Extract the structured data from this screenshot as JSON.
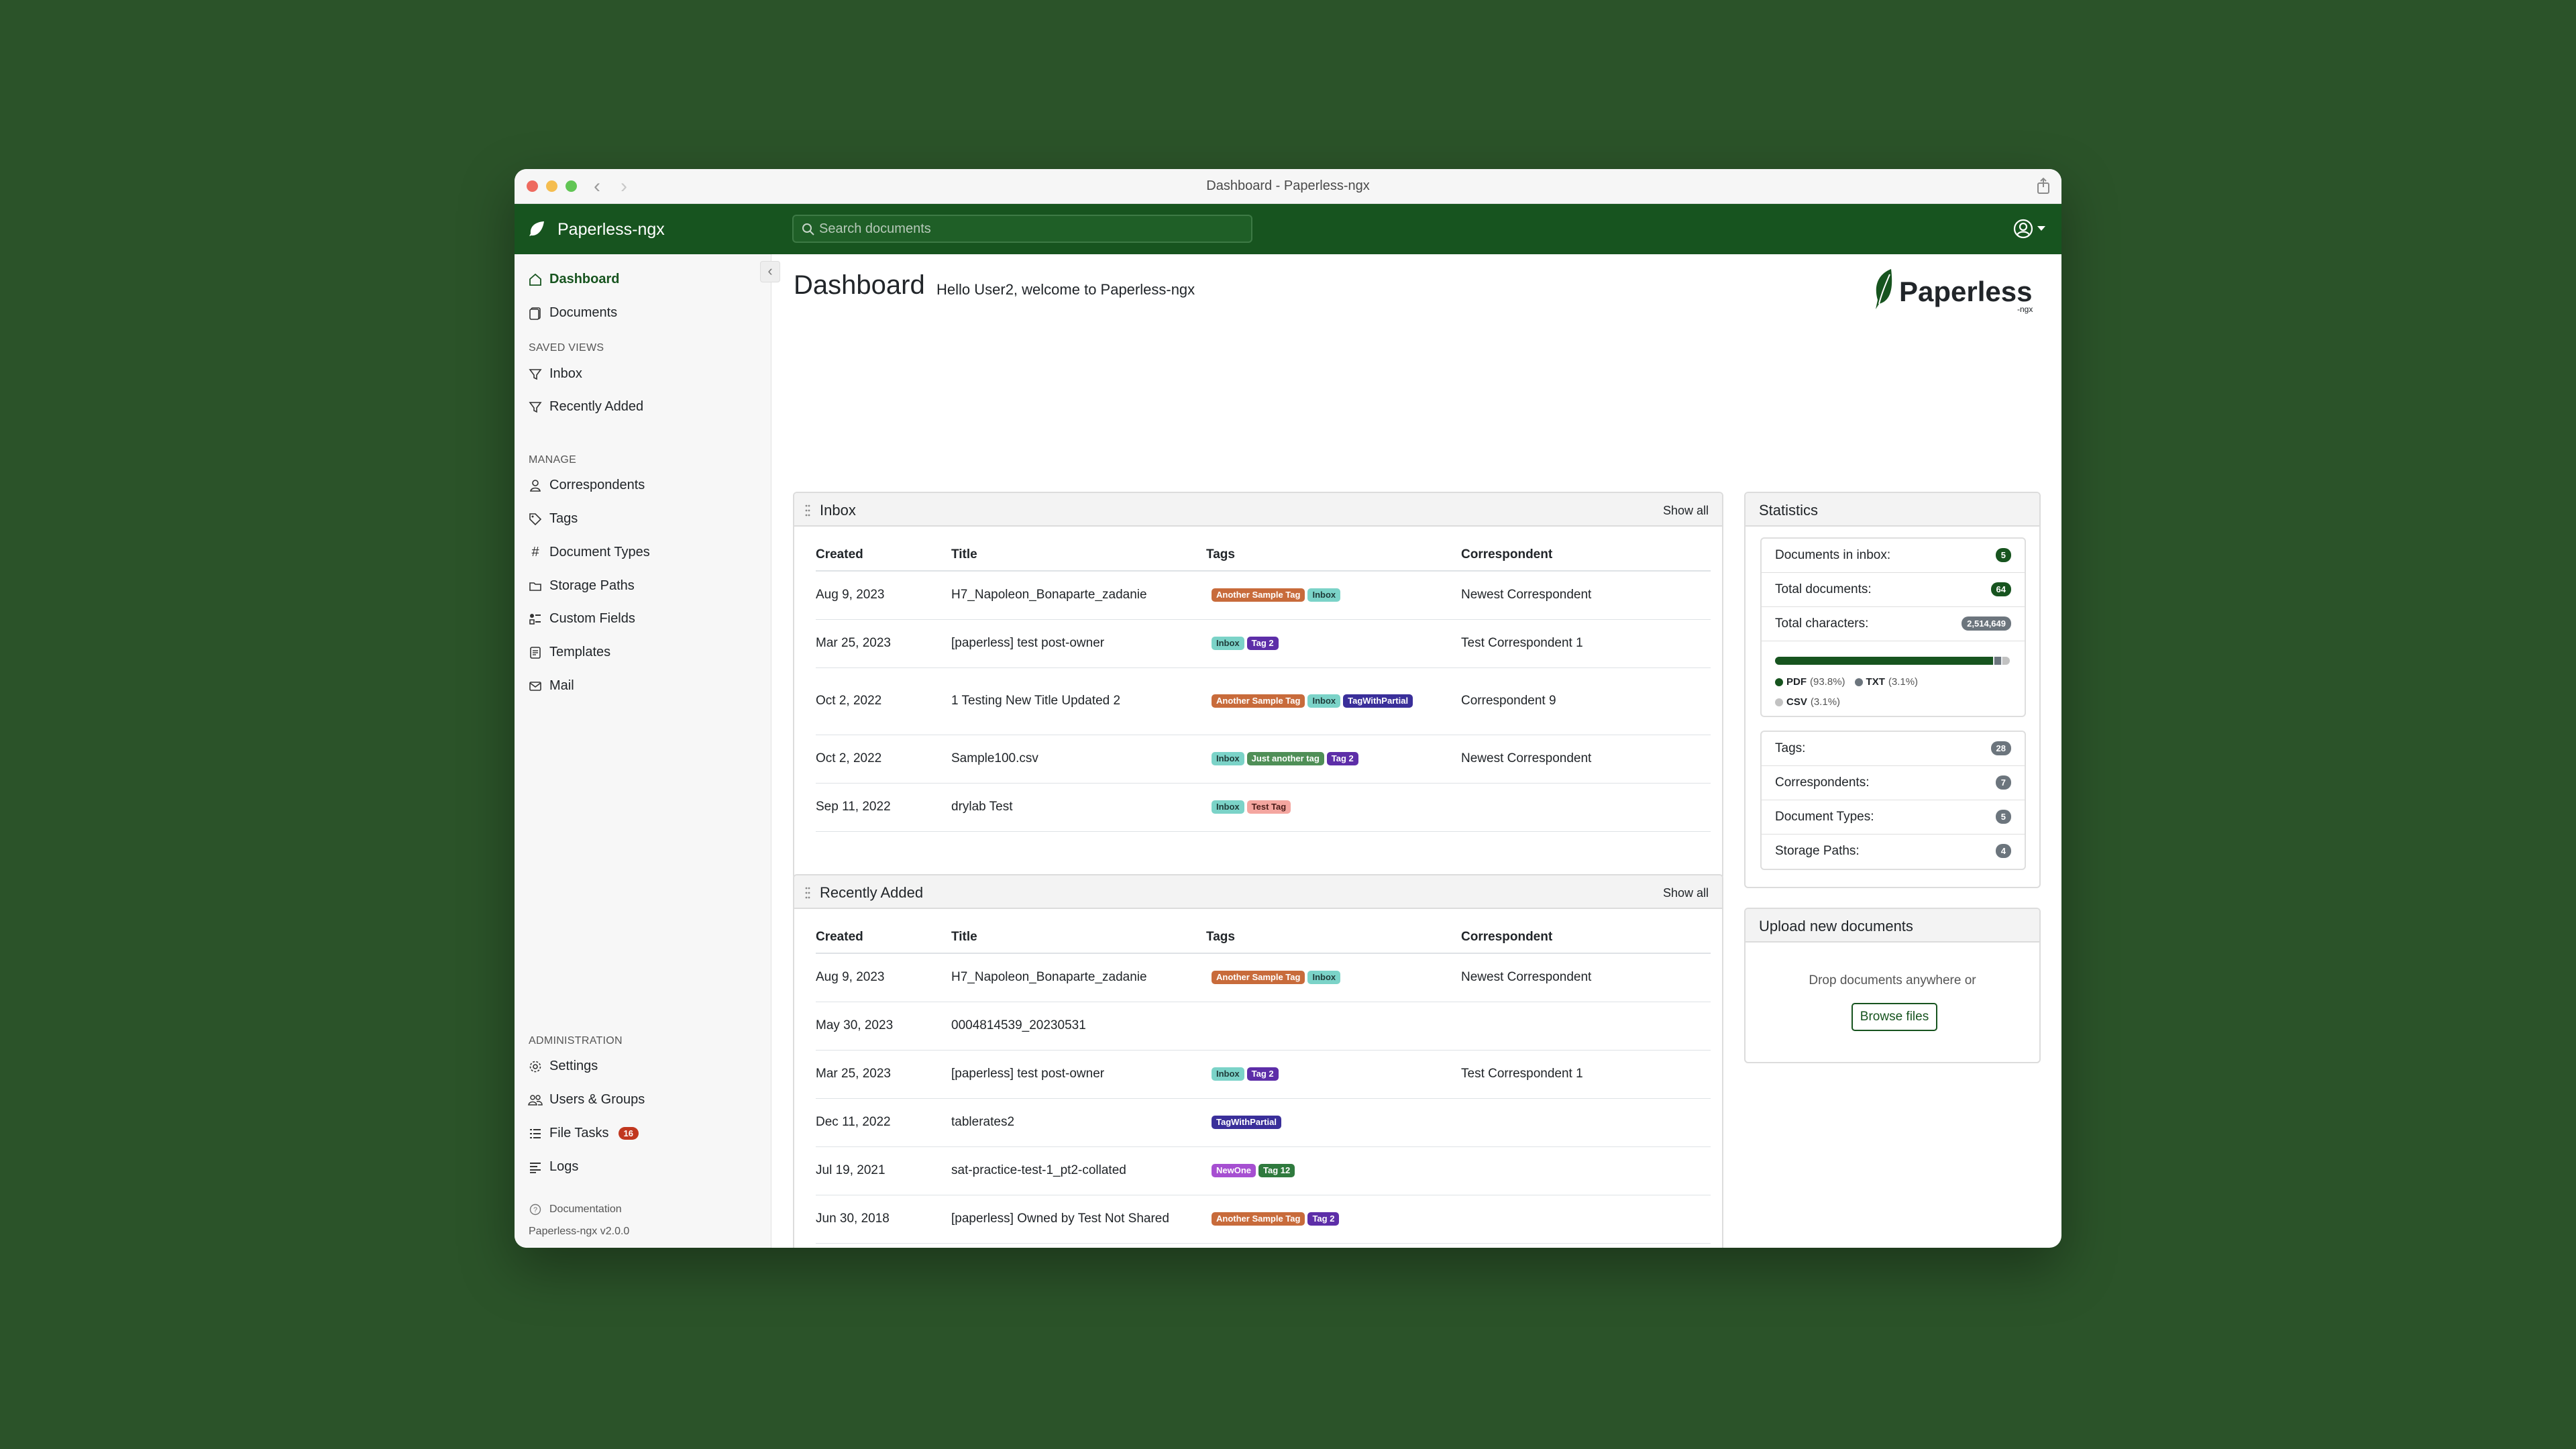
{
  "window": {
    "title": "Dashboard - Paperless-ngx"
  },
  "navbar": {
    "brand": "Paperless-ngx",
    "search_placeholder": "Search documents"
  },
  "sidebar": {
    "items": [
      {
        "label": "Dashboard",
        "icon": "house-icon",
        "active": true
      },
      {
        "label": "Documents",
        "icon": "files-icon"
      }
    ],
    "saved_views_label": "SAVED VIEWS",
    "saved_views": [
      {
        "label": "Inbox",
        "icon": "funnel-icon"
      },
      {
        "label": "Recently Added",
        "icon": "funnel-icon"
      }
    ],
    "manage_label": "MANAGE",
    "manage": [
      {
        "label": "Correspondents",
        "icon": "person-icon"
      },
      {
        "label": "Tags",
        "icon": "tags-icon"
      },
      {
        "label": "Document Types",
        "icon": "hash-icon"
      },
      {
        "label": "Storage Paths",
        "icon": "folder-icon"
      },
      {
        "label": "Custom Fields",
        "icon": "ui-radios-icon"
      },
      {
        "label": "Templates",
        "icon": "file-text-icon"
      },
      {
        "label": "Mail",
        "icon": "envelope-icon"
      }
    ],
    "admin_label": "ADMINISTRATION",
    "admin": [
      {
        "label": "Settings",
        "icon": "gear-icon"
      },
      {
        "label": "Users & Groups",
        "icon": "people-icon"
      },
      {
        "label": "File Tasks",
        "icon": "list-task-icon",
        "badge": "16"
      },
      {
        "label": "Logs",
        "icon": "text-left-icon"
      }
    ],
    "documentation": "Documentation",
    "version": "Paperless-ngx v2.0.0"
  },
  "main": {
    "title": "Dashboard",
    "welcome": "Hello User2, welcome to Paperless-ngx",
    "logo_text": "Paperless",
    "logo_sub": "-ngx"
  },
  "columns": [
    "Created",
    "Title",
    "Tags",
    "Correspondent"
  ],
  "tag_colors": {
    "Another Sample Tag": {
      "bg": "#c86b3b",
      "fg": "#ffffff"
    },
    "Inbox": {
      "bg": "#7bd3c8",
      "fg": "#1e3a38"
    },
    "Tag 2": {
      "bg": "#5d2ea8",
      "fg": "#ffffff"
    },
    "TagWithPartial": {
      "bg": "#3a2f9a",
      "fg": "#ffffff"
    },
    "Just another tag": {
      "bg": "#4f8f57",
      "fg": "#ffffff"
    },
    "Test Tag": {
      "bg": "#f4a6a0",
      "fg": "#4a1c18"
    },
    "NewOne": {
      "bg": "#a64fd1",
      "fg": "#ffffff"
    },
    "Tag 12": {
      "bg": "#2f7a3e",
      "fg": "#ffffff"
    }
  },
  "inbox": {
    "title": "Inbox",
    "show_all": "Show all",
    "rows": [
      {
        "created": "Aug 9, 2023",
        "title": "H7_Napoleon_Bonaparte_zadanie",
        "tags": [
          "Another Sample Tag",
          "Inbox"
        ],
        "correspondent": "Newest Correspondent"
      },
      {
        "created": "Mar 25, 2023",
        "title": "[paperless] test post-owner",
        "tags": [
          "Inbox",
          "Tag 2"
        ],
        "correspondent": "Test Correspondent 1"
      },
      {
        "created": "Oct 2, 2022",
        "title": "1 Testing New Title Updated 2",
        "tags": [
          "Another Sample Tag",
          "Inbox",
          "TagWithPartial"
        ],
        "correspondent": "Correspondent 9"
      },
      {
        "created": "Oct 2, 2022",
        "title": "Sample100.csv",
        "tags": [
          "Inbox",
          "Just another tag",
          "Tag 2"
        ],
        "correspondent": "Newest Correspondent"
      },
      {
        "created": "Sep 11, 2022",
        "title": "drylab Test",
        "tags": [
          "Inbox",
          "Test Tag"
        ],
        "correspondent": ""
      }
    ]
  },
  "recent": {
    "title": "Recently Added",
    "show_all": "Show all",
    "rows": [
      {
        "created": "Aug 9, 2023",
        "title": "H7_Napoleon_Bonaparte_zadanie",
        "tags": [
          "Another Sample Tag",
          "Inbox"
        ],
        "correspondent": "Newest Correspondent"
      },
      {
        "created": "May 30, 2023",
        "title": "0004814539_20230531",
        "tags": [],
        "correspondent": ""
      },
      {
        "created": "Mar 25, 2023",
        "title": "[paperless] test post-owner",
        "tags": [
          "Inbox",
          "Tag 2"
        ],
        "correspondent": "Test Correspondent 1"
      },
      {
        "created": "Dec 11, 2022",
        "title": "tablerates2",
        "tags": [
          "TagWithPartial"
        ],
        "correspondent": ""
      },
      {
        "created": "Jul 19, 2021",
        "title": "sat-practice-test-1_pt2-collated",
        "tags": [
          "NewOne",
          "Tag 12"
        ],
        "correspondent": ""
      },
      {
        "created": "Jun 30, 2018",
        "title": "[paperless] Owned by Test Not Shared",
        "tags": [
          "Another Sample Tag",
          "Tag 2"
        ],
        "correspondent": ""
      }
    ]
  },
  "statistics": {
    "title": "Statistics",
    "top": [
      {
        "label": "Documents in inbox:",
        "value": "5",
        "color": "green"
      },
      {
        "label": "Total documents:",
        "value": "64",
        "color": "green"
      },
      {
        "label": "Total characters:",
        "value": "2,514,649",
        "color": "gray"
      }
    ],
    "filetypes": [
      {
        "name": "PDF",
        "pct": "(93.8%)",
        "value": 93.8,
        "color": "#17541f"
      },
      {
        "name": "TXT",
        "pct": "(3.1%)",
        "value": 3.1,
        "color": "#6c757d"
      },
      {
        "name": "CSV",
        "pct": "(3.1%)",
        "value": 3.1,
        "color": "#c2c2c2"
      }
    ],
    "counts": [
      {
        "label": "Tags:",
        "value": "28"
      },
      {
        "label": "Correspondents:",
        "value": "7"
      },
      {
        "label": "Document Types:",
        "value": "5"
      },
      {
        "label": "Storage Paths:",
        "value": "4"
      }
    ]
  },
  "upload": {
    "title": "Upload new documents",
    "drop_text": "Drop documents anywhere or",
    "browse": "Browse files"
  }
}
